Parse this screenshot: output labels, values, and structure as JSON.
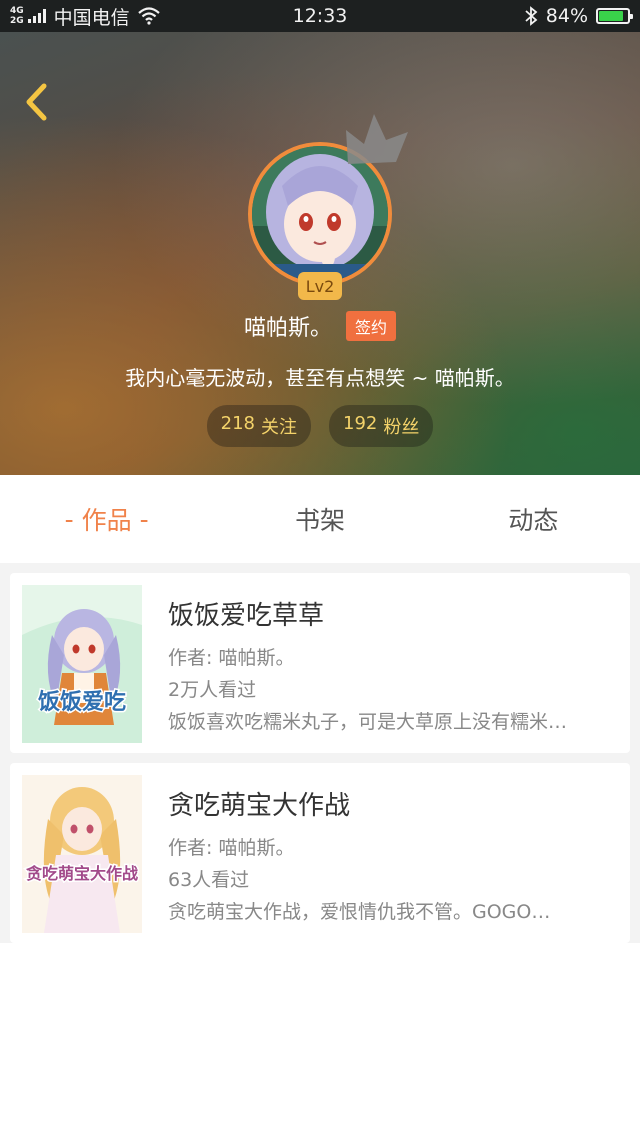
{
  "status_bar": {
    "network": "4G\n2G",
    "carrier": "中国电信",
    "time": "12:33",
    "battery": "84%",
    "battery_level": 0.84
  },
  "profile": {
    "level": "Lv2",
    "username": "喵帕斯。",
    "badge": "签约",
    "bio": "我内心毫无波动，甚至有点想笑 ~ 喵帕斯。",
    "following_count": "218",
    "following_label": "关注",
    "followers_count": "192",
    "followers_label": "粉丝"
  },
  "tabs": [
    {
      "label": "作品",
      "active": true
    },
    {
      "label": "书架",
      "active": false
    },
    {
      "label": "动态",
      "active": false
    }
  ],
  "tab_active_marker": "-",
  "books": [
    {
      "title": "饭饭爱吃草草",
      "author": "作者: 喵帕斯。",
      "views": "2万人看过",
      "description": "饭饭喜欢吃糯米丸子，可是大草原上没有糯米…",
      "cover_text": "饭饭爱吃"
    },
    {
      "title": "贪吃萌宝大作战",
      "author": "作者: 喵帕斯。",
      "views": "63人看过",
      "description": "贪吃萌宝大作战，爱恨情仇我不管。GOGO…",
      "cover_text": "贪吃萌宝大作战"
    }
  ],
  "colors": {
    "accent": "#f0824a",
    "badge": "#f0703f",
    "stat_text": "#f4d36a",
    "back_arrow": "#f4c542"
  }
}
